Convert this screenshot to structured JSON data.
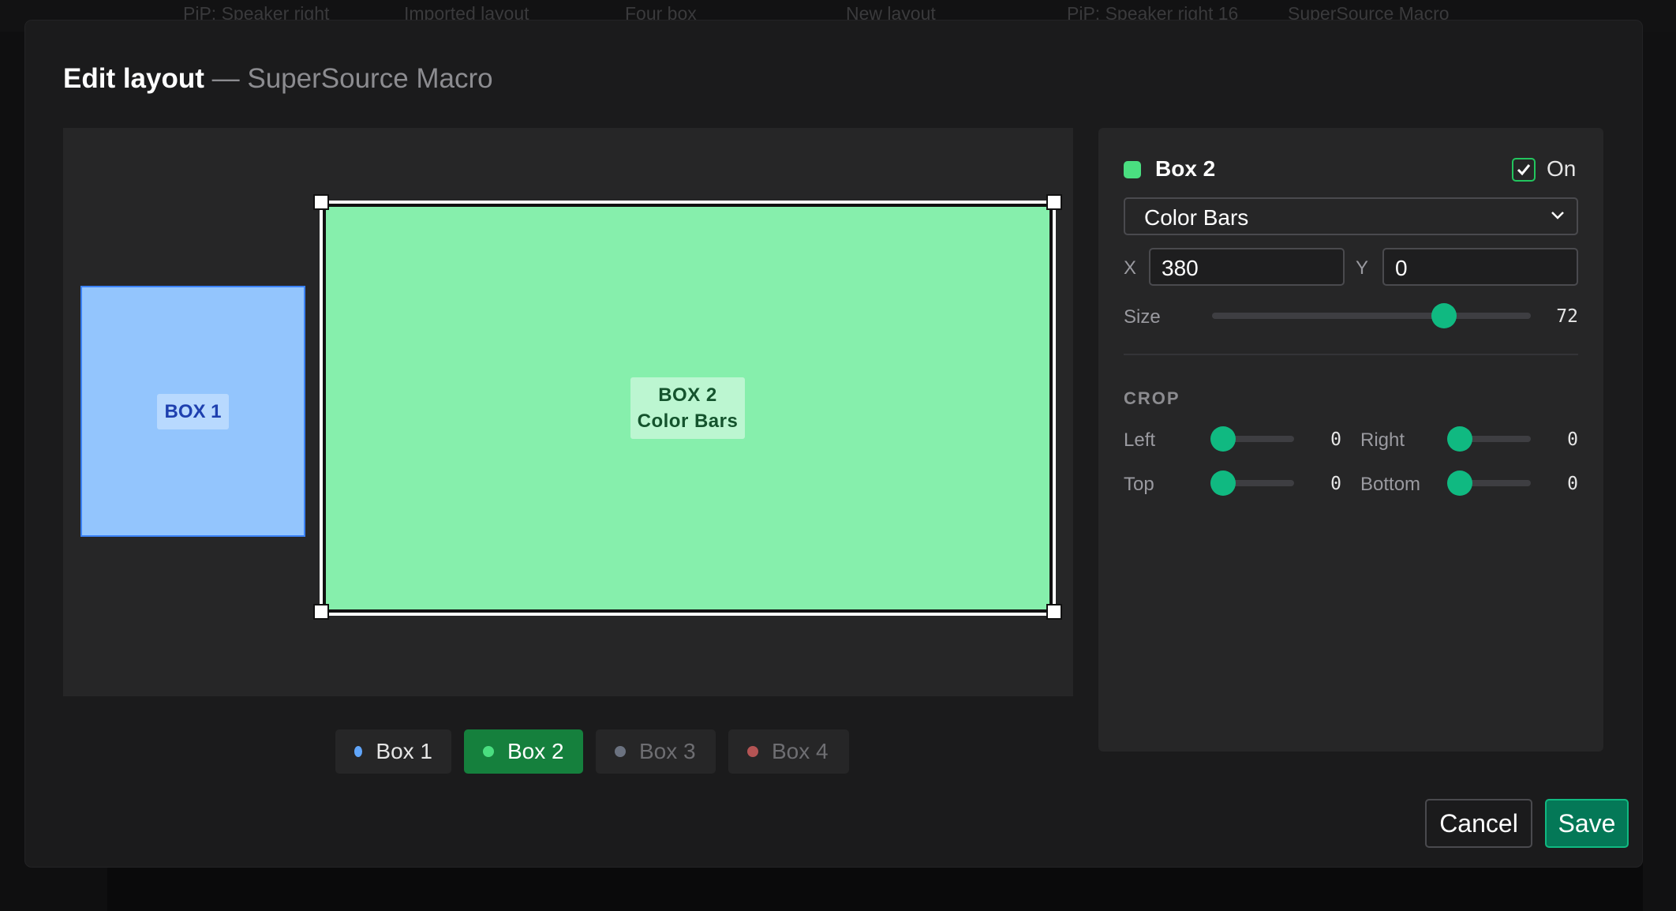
{
  "background_tabs": [
    "PiP: Speaker right",
    "Imported layout",
    "Four box",
    "New layout",
    "PiP: Speaker right 16",
    "SuperSource Macro"
  ],
  "modal": {
    "title": "Edit layout",
    "subtitle": "— SuperSource Macro"
  },
  "canvas": {
    "box1": {
      "label": "BOX 1",
      "color": "#93c5fd"
    },
    "box2": {
      "label_line1": "BOX 2",
      "label_line2": "Color Bars",
      "color": "#86efac"
    }
  },
  "box_tabs": [
    {
      "label": "Box 1",
      "dot_color": "#60a5fa",
      "selected": false,
      "enabled": true
    },
    {
      "label": "Box 2",
      "dot_color": "#4ade80",
      "selected": true,
      "enabled": true
    },
    {
      "label": "Box 3",
      "dot_color": "#6b7280",
      "selected": false,
      "enabled": false
    },
    {
      "label": "Box 4",
      "dot_color": "#b45454",
      "selected": false,
      "enabled": false
    }
  ],
  "panel": {
    "box_name": "Box 2",
    "swatch_color": "#4ade80",
    "on_label": "On",
    "on_checked": true,
    "source": "Color Bars",
    "x_label": "X",
    "x_value": "380",
    "y_label": "Y",
    "y_value": "0",
    "size_label": "Size",
    "size_value": "72",
    "crop_title": "CROP",
    "crop": {
      "left_label": "Left",
      "left_value": "0",
      "right_label": "Right",
      "right_value": "0",
      "top_label": "Top",
      "top_value": "0",
      "bottom_label": "Bottom",
      "bottom_value": "0"
    }
  },
  "buttons": {
    "cancel": "Cancel",
    "save": "Save"
  }
}
